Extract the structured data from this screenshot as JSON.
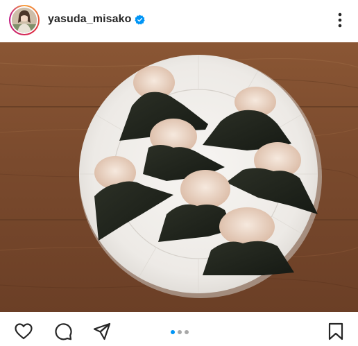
{
  "post": {
    "username": "yasuda_misako",
    "verified": true,
    "carousel": {
      "count": 3,
      "active_index": 0
    }
  },
  "icons": {
    "more": "more-options-icon",
    "like": "heart-icon",
    "comment": "comment-icon",
    "share": "share-icon",
    "save": "bookmark-icon",
    "verified": "verified-badge-icon"
  },
  "colors": {
    "verified_blue": "#0095f6",
    "carousel_active": "#0095f6",
    "carousel_inactive": "#a8a8a8",
    "icon": "#262626"
  }
}
